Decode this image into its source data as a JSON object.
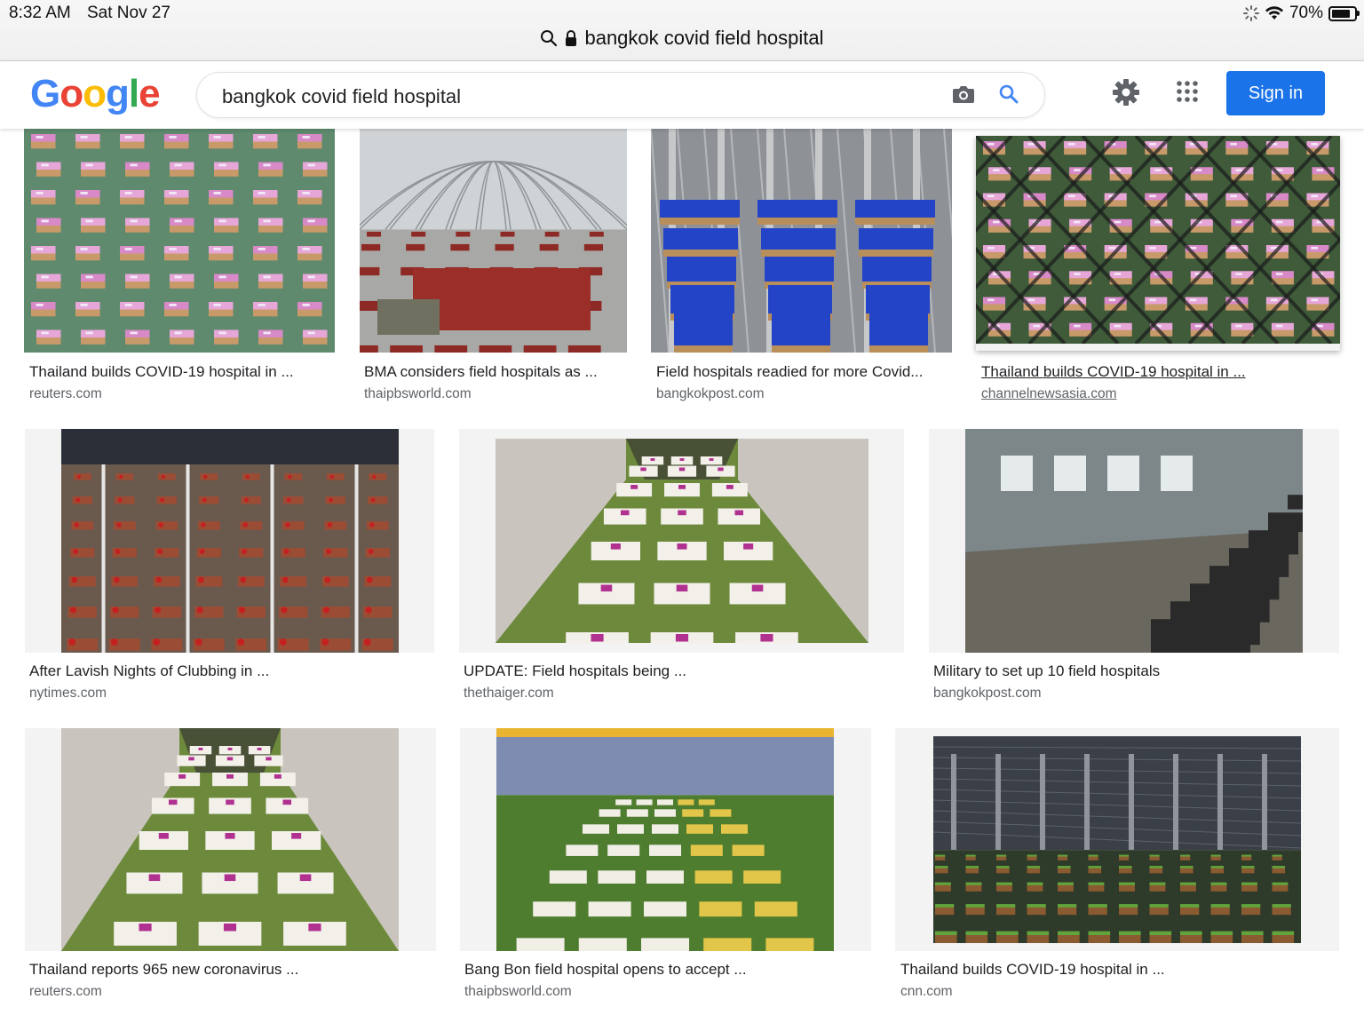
{
  "status": {
    "time": "8:32 AM",
    "date": "Sat Nov 27",
    "battery": "70%"
  },
  "address_bar": {
    "url_text": "bangkok covid field hospital"
  },
  "header": {
    "logo_letters": [
      {
        "ch": "G",
        "color": "#4285F4"
      },
      {
        "ch": "o",
        "color": "#EA4335"
      },
      {
        "ch": "o",
        "color": "#FBBC05"
      },
      {
        "ch": "g",
        "color": "#4285F4"
      },
      {
        "ch": "l",
        "color": "#34A853"
      },
      {
        "ch": "e",
        "color": "#EA4335"
      }
    ],
    "query": "bangkok covid field hospital",
    "sign_in": "Sign in"
  },
  "results": [
    {
      "title": "Thailand builds COVID-19 hospital in ...",
      "source": "reuters.com",
      "scene": "green-floor-beds"
    },
    {
      "title": "BMA considers field hospitals as ...",
      "source": "thaipbsworld.com",
      "scene": "tent-red-beds"
    },
    {
      "title": "Field hospitals readied for more Covid...",
      "source": "bangkokpost.com",
      "scene": "blue-beds-scaffold"
    },
    {
      "title": "Thailand builds COVID-19 hospital in ...",
      "source": "channelnewsasia.com",
      "scene": "fence-beds"
    },
    {
      "title": "After Lavish Nights of Clubbing in ...",
      "source": "nytimes.com",
      "scene": "hall-red-beds"
    },
    {
      "title": "UPDATE: Field hospitals being ...",
      "source": "thethaiger.com",
      "scene": "green-cubicles"
    },
    {
      "title": "Military to set up 10 field hospitals",
      "source": "bangkokpost.com",
      "scene": "warehouse-black-beds"
    },
    {
      "title": "Thailand reports 965 new coronavirus ...",
      "source": "reuters.com",
      "scene": "green-cubicles-2"
    },
    {
      "title": "Bang Bon field hospital opens to accept ...",
      "source": "thaipbsworld.com",
      "scene": "gym-yellow-beds"
    },
    {
      "title": "Thailand builds COVID-19 hospital in ...",
      "source": "cnn.com",
      "scene": "warehouse-green-beds"
    }
  ]
}
